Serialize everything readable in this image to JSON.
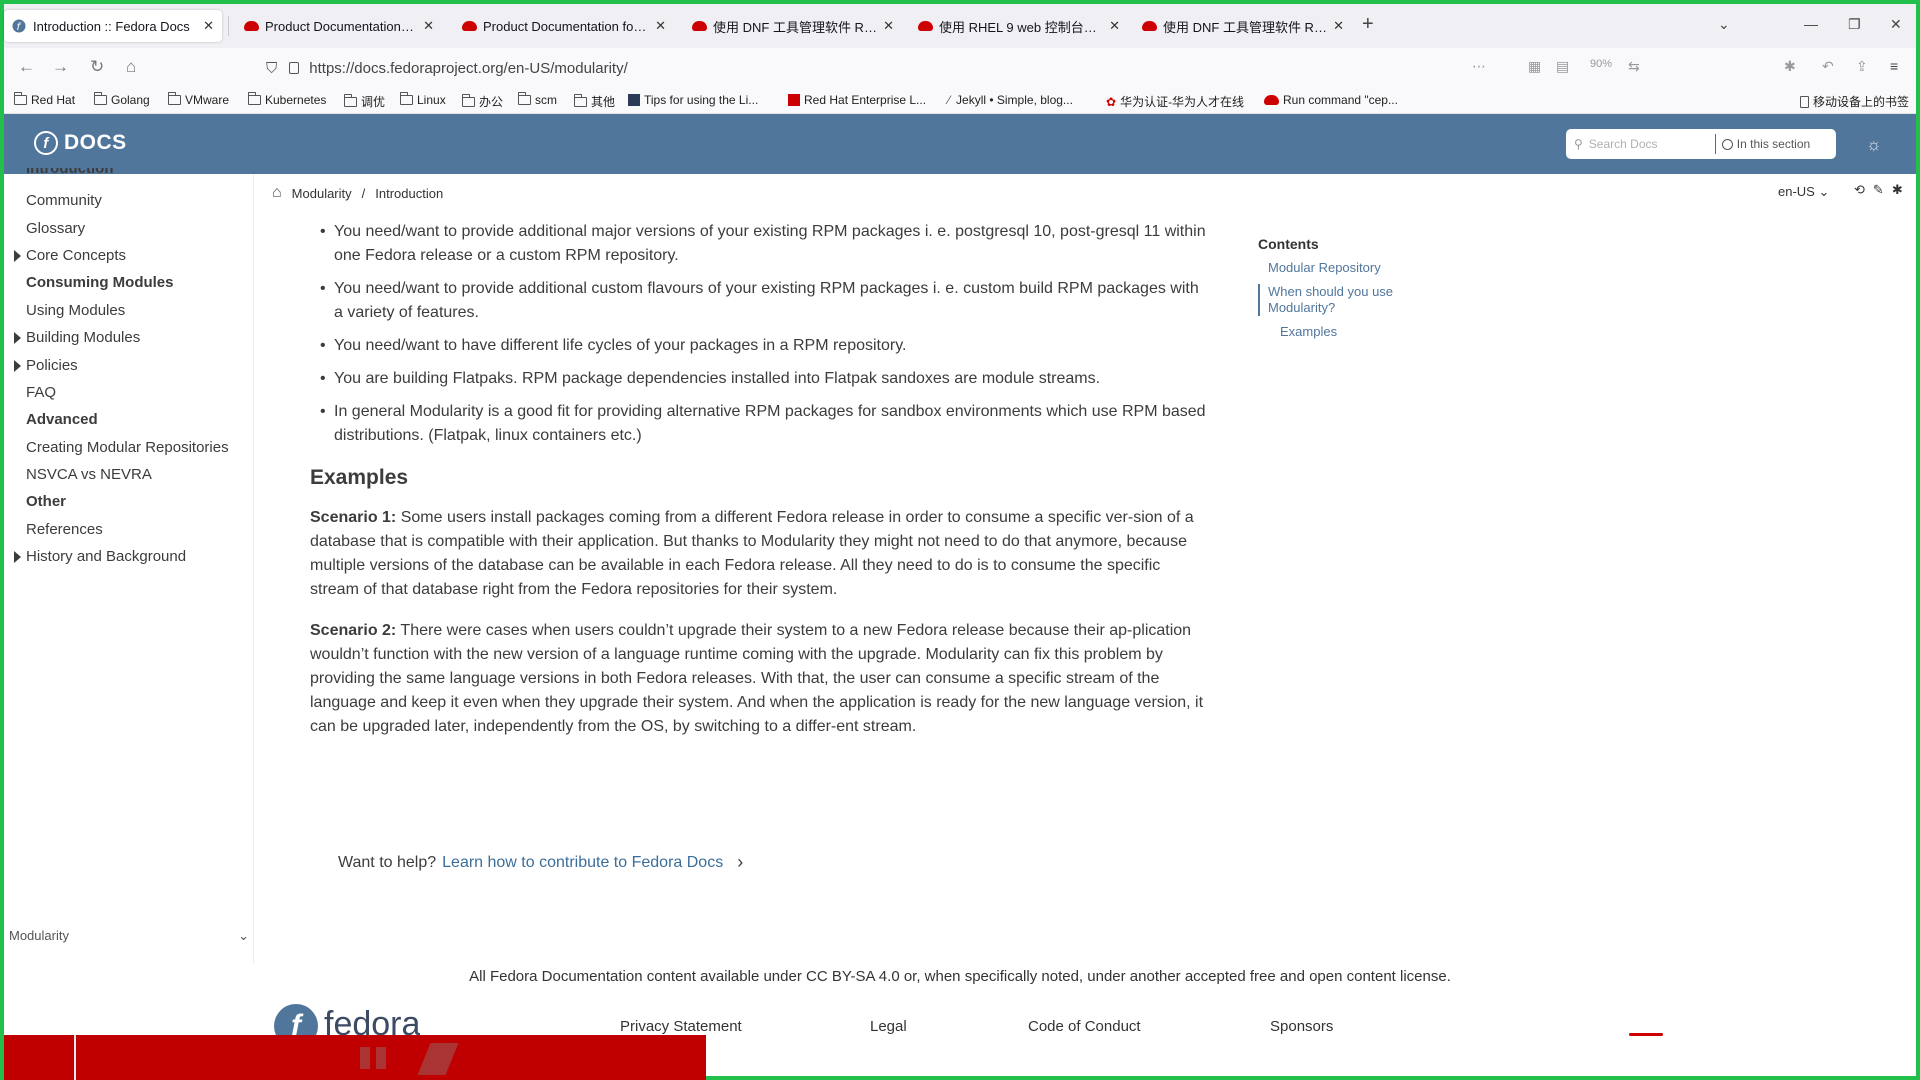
{
  "browser": {
    "tabs": [
      {
        "title": "Introduction :: Fedora Docs",
        "active": true,
        "icon": "fedora-icon"
      },
      {
        "title": "Product Documentation for R",
        "active": false,
        "icon": "redhat-icon"
      },
      {
        "title": "Product Documentation for R",
        "active": false,
        "icon": "redhat-icon"
      },
      {
        "title": "使用 DNF 工具管理软件 Red H",
        "active": false,
        "icon": "redhat-icon"
      },
      {
        "title": "使用 RHEL 9 web 控制台管理系",
        "active": false,
        "icon": "redhat-icon"
      },
      {
        "title": "使用 DNF 工具管理软件 Red H",
        "active": false,
        "icon": "redhat-icon"
      }
    ],
    "new_tab": "+",
    "url": "https://docs.fedoraproject.org/en-US/modularity/",
    "zoom": "90%",
    "bookmarks": [
      {
        "label": "Red Hat",
        "icon": "folder-icon"
      },
      {
        "label": "Golang",
        "icon": "folder-icon"
      },
      {
        "label": "VMware",
        "icon": "folder-icon"
      },
      {
        "label": "Kubernetes",
        "icon": "folder-icon"
      },
      {
        "label": "调优",
        "icon": "folder-icon"
      },
      {
        "label": "Linux",
        "icon": "folder-icon"
      },
      {
        "label": "办公",
        "icon": "folder-icon"
      },
      {
        "label": "scm",
        "icon": "folder-icon"
      },
      {
        "label": "其他",
        "icon": "folder-icon"
      },
      {
        "label": "Tips for using the Li...",
        "icon": "page-icon"
      },
      {
        "label": "Red Hat Enterprise L...",
        "icon": "redhat-icon"
      },
      {
        "label": "Jekyll • Simple, blog...",
        "icon": "jekyll-icon"
      },
      {
        "label": "华为认证-华为人才在线",
        "icon": "huawei-icon"
      },
      {
        "label": "Run command \"cep...",
        "icon": "redhat-icon"
      }
    ],
    "mobile_bookmarks": "移动设备上的书签"
  },
  "docs_header": {
    "logo_text": "DOCS",
    "search_placeholder": "Search Docs",
    "in_this_section": "In this section"
  },
  "sidebar": {
    "cut_item": "Introduction",
    "items": [
      {
        "label": "Community",
        "bold": false,
        "expandable": false
      },
      {
        "label": "Glossary",
        "bold": false,
        "expandable": false
      },
      {
        "label": "Core Concepts",
        "bold": false,
        "expandable": true
      },
      {
        "label": "Consuming Modules",
        "bold": true,
        "expandable": false
      },
      {
        "label": "Using Modules",
        "bold": false,
        "expandable": false
      },
      {
        "label": "Building Modules",
        "bold": false,
        "expandable": true
      },
      {
        "label": "Policies",
        "bold": false,
        "expandable": true
      },
      {
        "label": "FAQ",
        "bold": false,
        "expandable": false
      },
      {
        "label": "Advanced",
        "bold": true,
        "expandable": false
      },
      {
        "label": "Creating Modular Repositories",
        "bold": false,
        "expandable": false
      },
      {
        "label": "NSVCA vs NEVRA",
        "bold": false,
        "expandable": false
      },
      {
        "label": "Other",
        "bold": true,
        "expandable": false
      },
      {
        "label": "References",
        "bold": false,
        "expandable": false
      },
      {
        "label": "History and Background",
        "bold": false,
        "expandable": true
      }
    ],
    "component_select": "Modularity"
  },
  "breadcrumb": {
    "items": [
      "Modularity",
      "Introduction"
    ],
    "separator": "/",
    "lang": "en-US"
  },
  "content": {
    "bullets": [
      "You need/want to provide additional major versions of your existing RPM packages i. e. postgresql 10, post-gresql 11 within one Fedora release or a custom RPM repository.",
      "You need/want to provide additional custom flavours of your existing RPM packages i. e. custom build RPM packages with a variety of features.",
      "You need/want to have different life cycles of your packages in a RPM repository.",
      "You are building Flatpaks. RPM package dependencies installed into Flatpak sandoxes are module streams.",
      "In general Modularity is a good fit for providing alternative RPM packages for sandbox environments which use RPM based distributions. (Flatpak, linux containers etc.)"
    ],
    "examples_heading": "Examples",
    "scenario1_label": "Scenario 1:",
    "scenario1_text": " Some users install packages coming from a different Fedora release in order to consume a specific ver-sion of a database that is compatible with their application. But thanks to Modularity they might not need to do that anymore, because multiple versions of the database can be available in each Fedora release. All they need to do is to consume the specific stream of that database right from the Fedora repositories for their system.",
    "scenario2_label": "Scenario 2:",
    "scenario2_text": " There were cases when users couldn’t upgrade their system to a new Fedora release because their ap-plication wouldn’t function with the new version of a language runtime coming with the upgrade. Modularity can fix this problem by providing the same language versions in both Fedora releases. With that, the user can consume a specific stream of the language and keep it even when they upgrade their system. And when the application is ready for the new language version, it can be upgraded later, independently from the OS, by switching to a differ-ent stream.",
    "help_prefix": "Want to help?",
    "help_link": "Learn how to contribute to Fedora Docs"
  },
  "toc": {
    "heading": "Contents",
    "items": [
      {
        "label": "Modular Repository",
        "active": false,
        "sub": false
      },
      {
        "label": "When should you use Modularity?",
        "active": true,
        "sub": false
      },
      {
        "label": "Examples",
        "active": false,
        "sub": true
      }
    ]
  },
  "footer": {
    "license": "All Fedora Documentation content available under CC BY-SA 4.0 or, when specifically noted, under another accepted free and open content license.",
    "logo_text": "fedora",
    "links": [
      "Privacy Statement",
      "Legal",
      "Code of Conduct",
      "Sponsors"
    ]
  },
  "colors": {
    "header_blue": "#51769c",
    "link_blue": "#3c6e9c",
    "record_red": "#c00000",
    "frame_green": "#22c04a"
  }
}
